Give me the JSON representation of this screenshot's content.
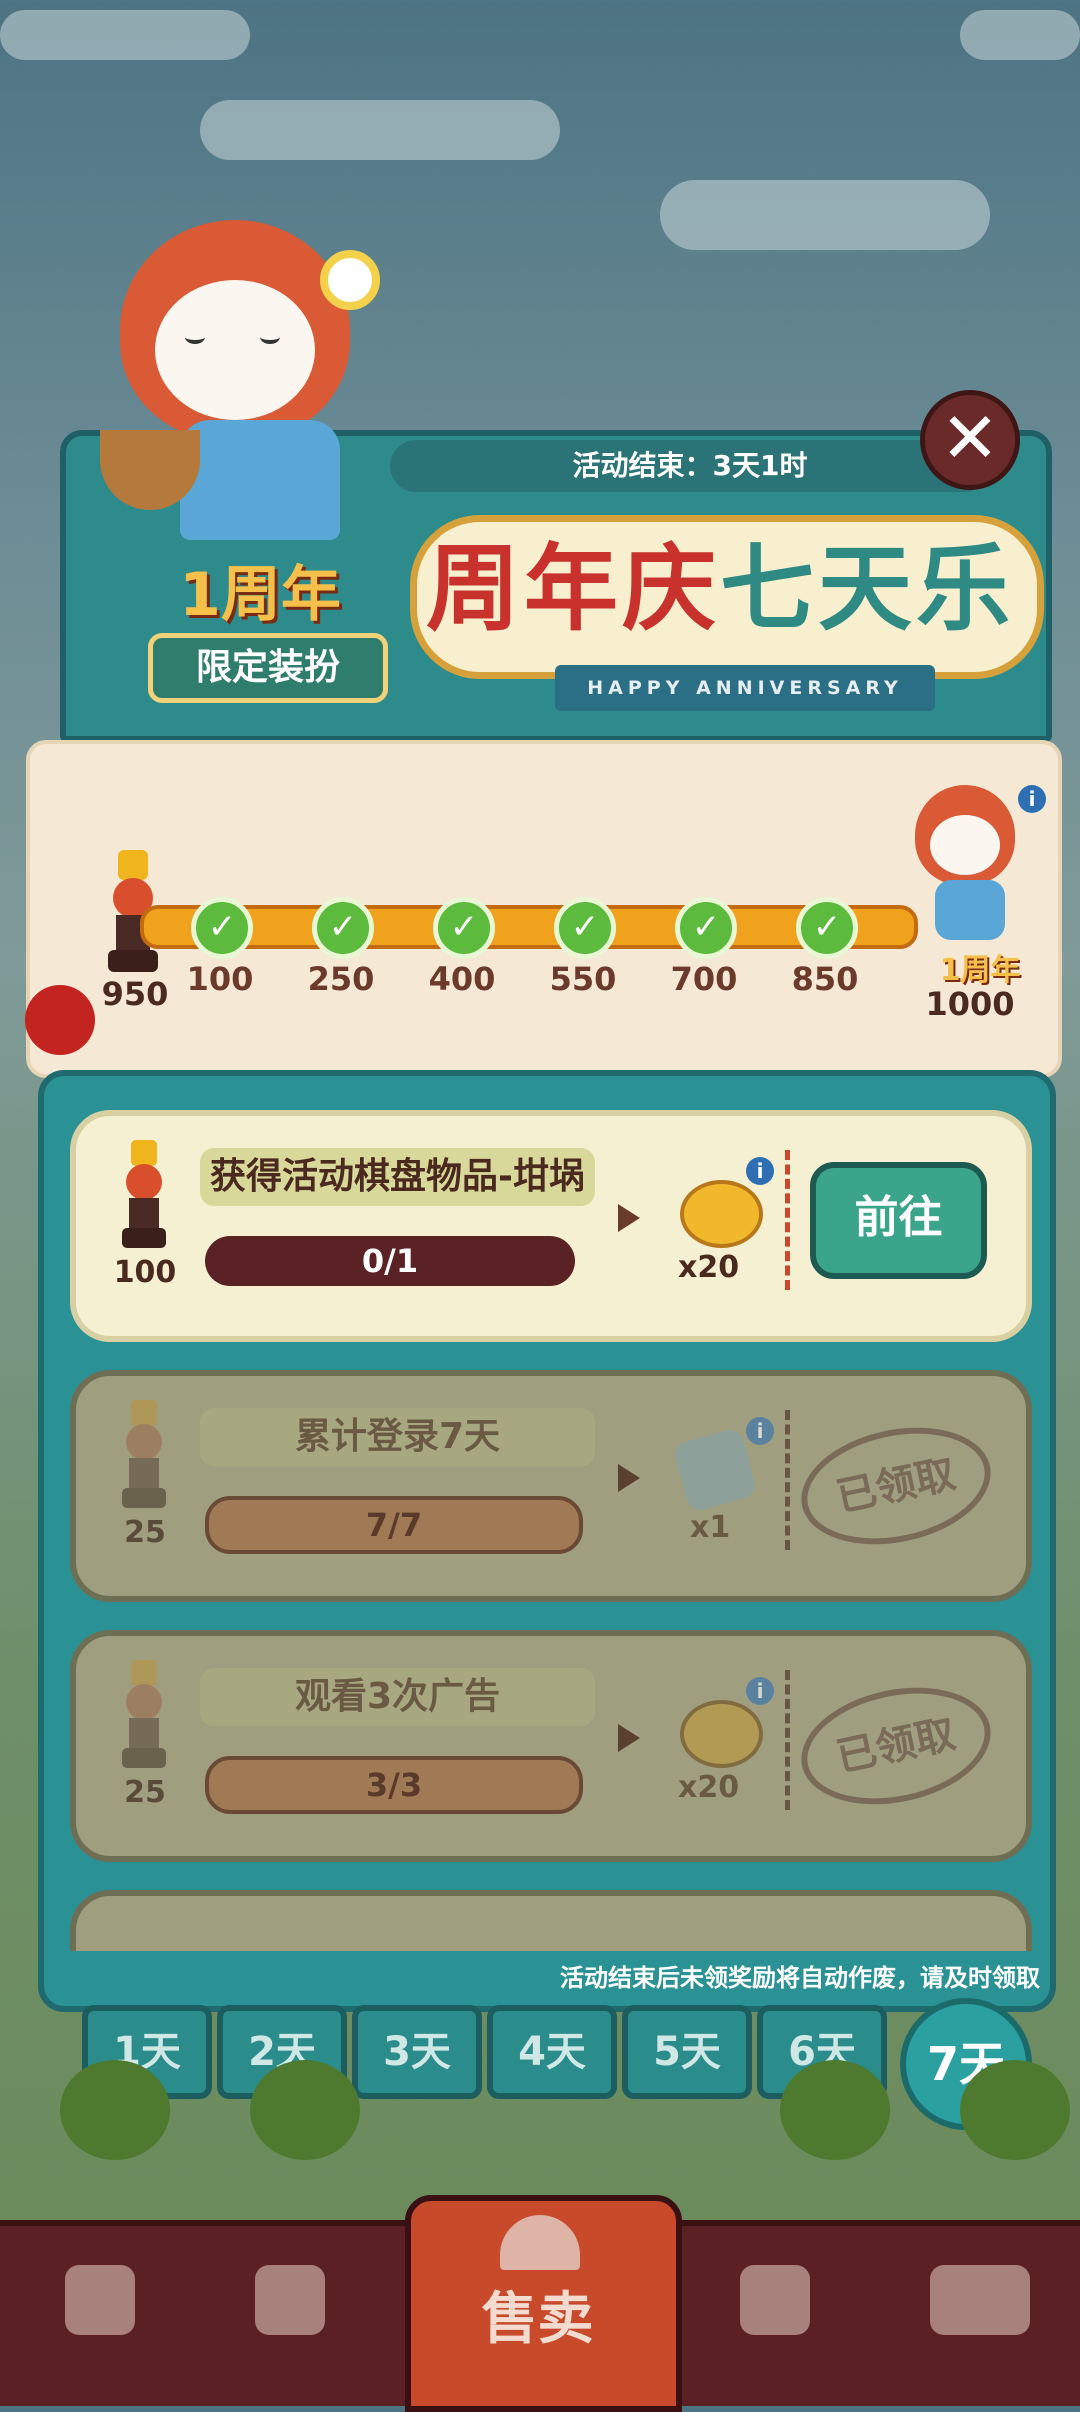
{
  "header": {
    "deadline": "活动结束：3天1时",
    "title_part1": "周年庆",
    "title_part2": "七天乐",
    "subtitle": "HAPPY ANNIVERSARY",
    "anniversary_badge": "1周年",
    "limited_tag": "限定装扮",
    "close_icon": "close-icon"
  },
  "progress": {
    "current_points": "950",
    "milestones": [
      "100",
      "250",
      "400",
      "550",
      "700",
      "850"
    ],
    "final_goal": "1000",
    "final_reward_badge": "1周年",
    "completed_milestones": 6,
    "colors": {
      "track": "#f0a21c",
      "node": "#5cba3c"
    }
  },
  "tasks": [
    {
      "title": "获得活动棋盘物品-坩埚",
      "points": "100",
      "progress": "0/1",
      "reward_qty": "x20",
      "reward_icon": "paw-coin-icon",
      "action": "前往",
      "state": "active"
    },
    {
      "title": "累计登录7天",
      "points": "25",
      "progress": "7/7",
      "reward_qty": "x1",
      "reward_icon": "ticket-icon",
      "action": "已领取",
      "state": "claimed"
    },
    {
      "title": "观看3次广告",
      "points": "25",
      "progress": "3/3",
      "reward_qty": "x20",
      "reward_icon": "paw-coin-icon",
      "action": "已领取",
      "state": "claimed"
    }
  ],
  "notice": "活动结束后未领奖励将自动作废，请及时领取",
  "days": [
    "1天",
    "2天",
    "3天",
    "4天",
    "5天",
    "6天",
    "7天"
  ],
  "selected_day": "7天",
  "bottom_nav": {
    "items": [
      "bag-icon",
      "hands-icon",
      "售卖",
      "map-pin-icon",
      "bus-icon"
    ],
    "active_label": "售卖"
  }
}
